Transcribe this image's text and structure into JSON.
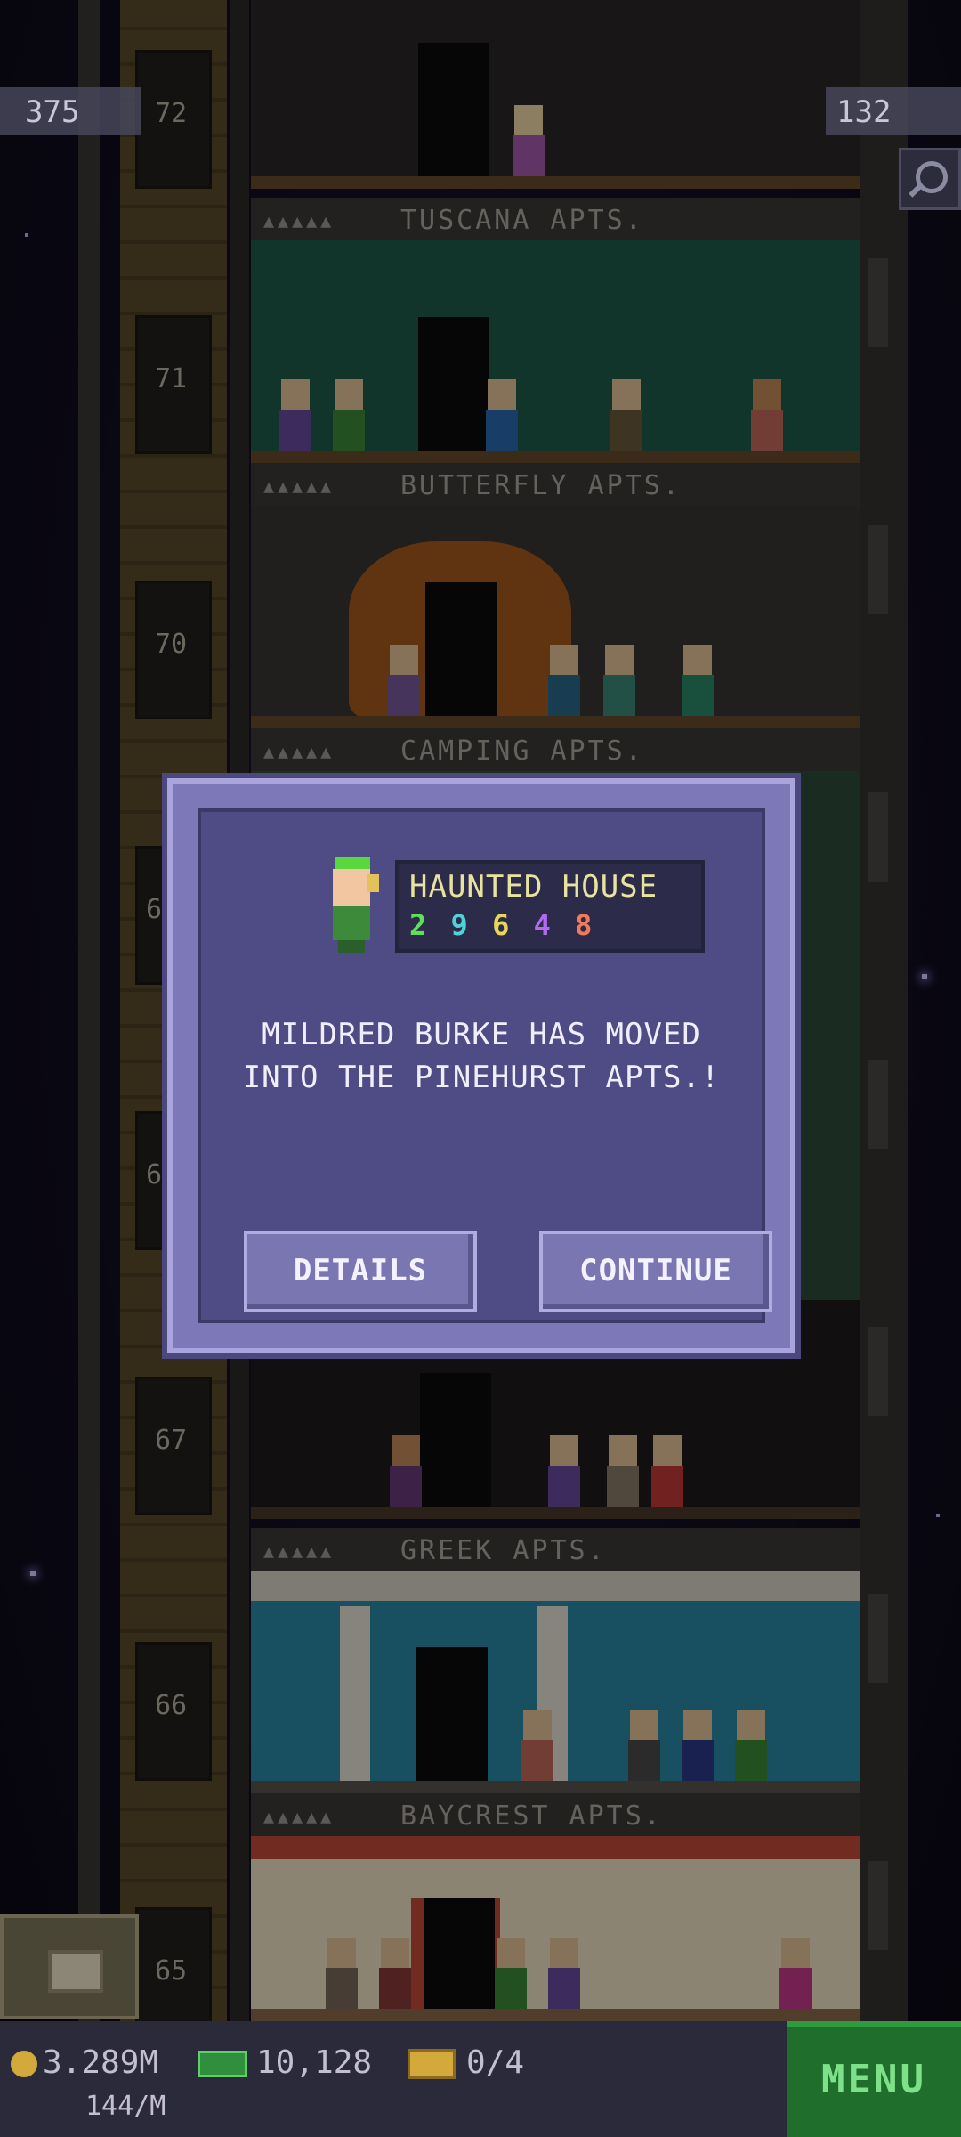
{
  "hud": {
    "population": "375",
    "floors": "132"
  },
  "floors": [
    {
      "number": "72"
    },
    {
      "number": "71"
    },
    {
      "number": "70"
    },
    {
      "number": "67"
    },
    {
      "number": "66"
    },
    {
      "number": "65"
    }
  ],
  "partial_floor_numbers": [
    "6",
    "6"
  ],
  "floor_labels": [
    {
      "pips": "▲▲▲▲▲",
      "name": "TUSCANA APTS."
    },
    {
      "pips": "▲▲▲▲▲",
      "name": "BUTTERFLY APTS."
    },
    {
      "pips": "▲▲▲▲▲",
      "name": "CAMPING APTS."
    },
    {
      "pips": "▲▲▲▲▲",
      "name": "GREEK APTS."
    },
    {
      "pips": "▲▲▲▲▲",
      "name": "BAYCREST APTS."
    }
  ],
  "dialog": {
    "dream_job": "HAUNTED HOUSE",
    "stats": [
      {
        "value": "2",
        "color": "#5ee05a"
      },
      {
        "value": "9",
        "color": "#4fd3d8"
      },
      {
        "value": "6",
        "color": "#e8d65a"
      },
      {
        "value": "4",
        "color": "#b36af0"
      },
      {
        "value": "8",
        "color": "#f07a5a"
      }
    ],
    "message": "MILDRED BURKE HAS MOVED INTO THE PINEHURST APTS.!",
    "details_label": "DETAILS",
    "continue_label": "CONTINUE"
  },
  "bottom": {
    "coins": "3.289M",
    "coin_rate": "144/M",
    "bux": "10,128",
    "tickets": "0/4",
    "menu_label": "MENU"
  },
  "colors": {
    "menu": "#1f6e2c",
    "dialog": "#4f4b85",
    "dialog_border": "#7d79b8"
  }
}
